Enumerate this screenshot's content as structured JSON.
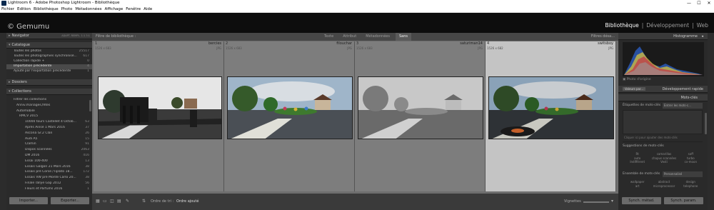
{
  "window": {
    "title": "Lightroom 6 - Adobe Photoshop Lightroom - Bibliothèque",
    "controls": [
      "—",
      "☐",
      "✕"
    ]
  },
  "menu": [
    "Fichier",
    "Edition",
    "Bibliothèque",
    "Photo",
    "Métadonnées",
    "Affichage",
    "Fenêtre",
    "Aide"
  ],
  "identity": {
    "brand": "© Gemumu",
    "modules": [
      "Bibliothèque",
      "Développement",
      "Web"
    ],
    "active_module": "Bibliothèque"
  },
  "left": {
    "navigator": {
      "title": "Navigator",
      "options": "ADAPT.   REMPL.   1:1   3:1"
    },
    "catalog": {
      "title": "Catalogue",
      "items": [
        {
          "label": "Toutes les photos",
          "count": "25517"
        },
        {
          "label": "Toutes les photographies synchronisé...",
          "count": "617"
        },
        {
          "label": "Collection rapide +",
          "count": "0"
        },
        {
          "label": "Importation précédente",
          "count": "4"
        },
        {
          "label": "Ajouté par l'exportation précédente",
          "count": "1"
        }
      ]
    },
    "folders": {
      "title": "Dossiers"
    },
    "collections": {
      "title": "Collections",
      "items": [
        {
          "label": "Filtrer les collections",
          "count": ""
        },
        {
          "label": "Anniv.mariages,fêtes",
          "count": ""
        },
        {
          "label": "Automobile",
          "count": ""
        },
        {
          "label": "RMCV 2015",
          "count": ""
        },
        {
          "label": "10000 tours Castellet 4 Octob...",
          "count": "63"
        },
        {
          "label": "Après Ainsé 1 Mars 2016",
          "count": "37"
        },
        {
          "label": "Ascona Gr.2 Clan",
          "count": "26"
        },
        {
          "label": "Audi A5",
          "count": "15"
        },
        {
          "label": "Clamin",
          "count": "91"
        },
        {
          "label": "Dispos scannées",
          "count": "2063"
        },
        {
          "label": "DM 2016",
          "count": "416"
        },
        {
          "label": "Essai 100-400",
          "count": "13"
        },
        {
          "label": "Essais Galgon 21 Mars 2016",
          "count": "38"
        },
        {
          "label": "Essais pré Corse /Tiplato 18...",
          "count": "172"
        },
        {
          "label": "Essais VW pré Monte Carlo 20...",
          "count": "38"
        },
        {
          "label": "Finale rallye Gap 2012",
          "count": "56"
        },
        {
          "label": "Fleurs et Parfums 2016",
          "count": "1"
        }
      ]
    },
    "import_label": "Importer...",
    "export_label": "Exporter..."
  },
  "filter": {
    "label": "Filtre de bibliothèque :",
    "buttons": [
      "Texte",
      "Attribut",
      "Métadonnées",
      "Sans"
    ],
    "active": "Sans",
    "off_label": "Filtres désa..."
  },
  "grid": [
    {
      "num": "1",
      "dims": "1526 x 683",
      "name": "bercies",
      "ext": "JPG"
    },
    {
      "num": "2",
      "dims": "1526 x 683",
      "name": "filouchar",
      "ext": "JPG"
    },
    {
      "num": "3",
      "dims": "1526 x 683",
      "name": "saturiman14",
      "ext": "JPG"
    },
    {
      "num": "4",
      "dims": "1526 x 682",
      "name": "switsboy",
      "ext": "JPG"
    }
  ],
  "toolbar": {
    "sort_label": "Ordre de tri :",
    "sort_value": "Ordre ajouté",
    "thumb_label": "Vignettes"
  },
  "right": {
    "histogram_title": "Histogramme",
    "photo_label": "Photo d'origine",
    "quick_develop": {
      "preset": "Valeurs par...",
      "title": "Développement rapide"
    },
    "keywords_title": "Mots-clés",
    "keyword_tags_label": "Étiquettes de mots-clés",
    "keyword_tags_value": "Entrer les mots-c...",
    "keyword_placeholder": "Cliquer ici pour ajouter des mots-clés",
    "suggestions_title": "Suggestions de mots-clés",
    "suggestions": [
      "Rt",
      "camarillas",
      "soff",
      "auto",
      "chapus scannées",
      "turbo",
      "Indifférent",
      "Vesti",
      "cx-moon"
    ],
    "set_title": "Ensemble de mots-clés",
    "set_value": "Personnalisé",
    "set_items": [
      "wallpaper",
      "abstract",
      "design",
      "art",
      "microprocessor",
      "telephone"
    ],
    "sync_meta": "Synch. métad.",
    "sync_params": "Synch. param."
  }
}
